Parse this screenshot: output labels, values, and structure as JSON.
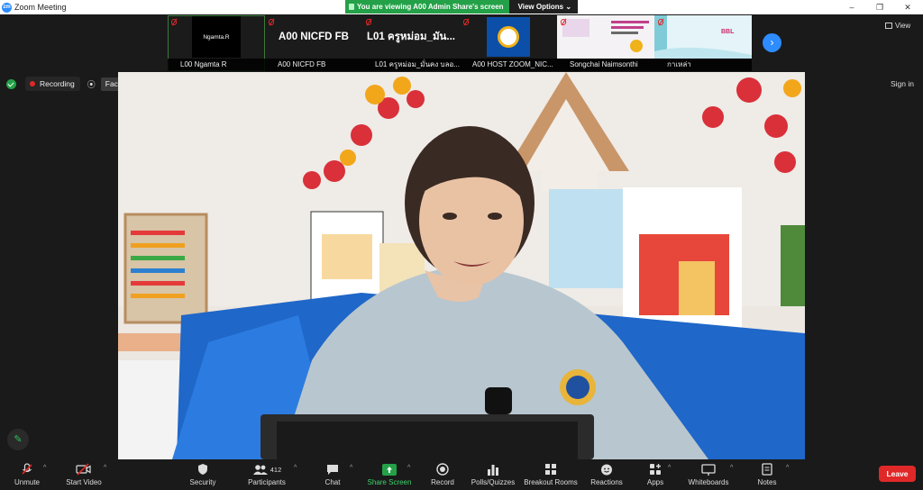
{
  "window": {
    "title": "Zoom Meeting",
    "logo_text": "zm",
    "controls": [
      "–",
      "❐",
      "✕"
    ]
  },
  "share_banner": {
    "message": "You are viewing A00 Admin Share's screen",
    "options_label": "View Options ⌄"
  },
  "thumbnails": [
    {
      "tile_text": "Ngamta.R",
      "label": "L00 Ngamta R",
      "muted": true,
      "pinned": true
    },
    {
      "tile_text": "A00 NICFD FB",
      "label": "A00 NICFD FB",
      "muted": true
    },
    {
      "tile_text": "L01 ครูหม่อม_มัน...",
      "label": "L01 ครูหม่อม_มั่นคง บลอ...",
      "muted": true
    },
    {
      "tile_text": "",
      "label": "A00 HOST ZOOM_NIC...",
      "muted": true
    },
    {
      "tile_text": "",
      "label": "Songchai Naimsonthi",
      "muted": true
    },
    {
      "tile_text": "BBL",
      "label": "กาเหล่า",
      "muted": true
    }
  ],
  "view_label": "View",
  "status": {
    "recording_label": "Recording",
    "facebook_label": "Facebook ⌄",
    "signin_label": "Sign in"
  },
  "colors": {
    "accent_blue": "#2d8cff",
    "share_green": "#24a148",
    "leave_red": "#e02828"
  },
  "toolbar": {
    "unmute": "Unmute",
    "start_video": "Start Video",
    "security": "Security",
    "participants": "Participants",
    "participants_count": "412",
    "chat": "Chat",
    "share_screen": "Share Screen",
    "record": "Record",
    "polls": "Polls/Quizzes",
    "breakout": "Breakout Rooms",
    "reactions": "Reactions",
    "apps": "Apps",
    "whiteboards": "Whiteboards",
    "notes": "Notes",
    "leave": "Leave"
  },
  "icons": {
    "mic_muted": "mic-off-icon",
    "video_off": "video-off-icon",
    "security": "shield-icon",
    "participants": "people-icon",
    "chat": "chat-bubble-icon",
    "share": "share-up-arrow-icon",
    "record": "record-circle-icon",
    "polls": "bar-chart-icon",
    "breakout": "grid-icon",
    "reactions": "smiley-plus-icon",
    "apps": "apps-plus-icon",
    "whiteboards": "whiteboard-icon",
    "notes": "notes-icon"
  }
}
